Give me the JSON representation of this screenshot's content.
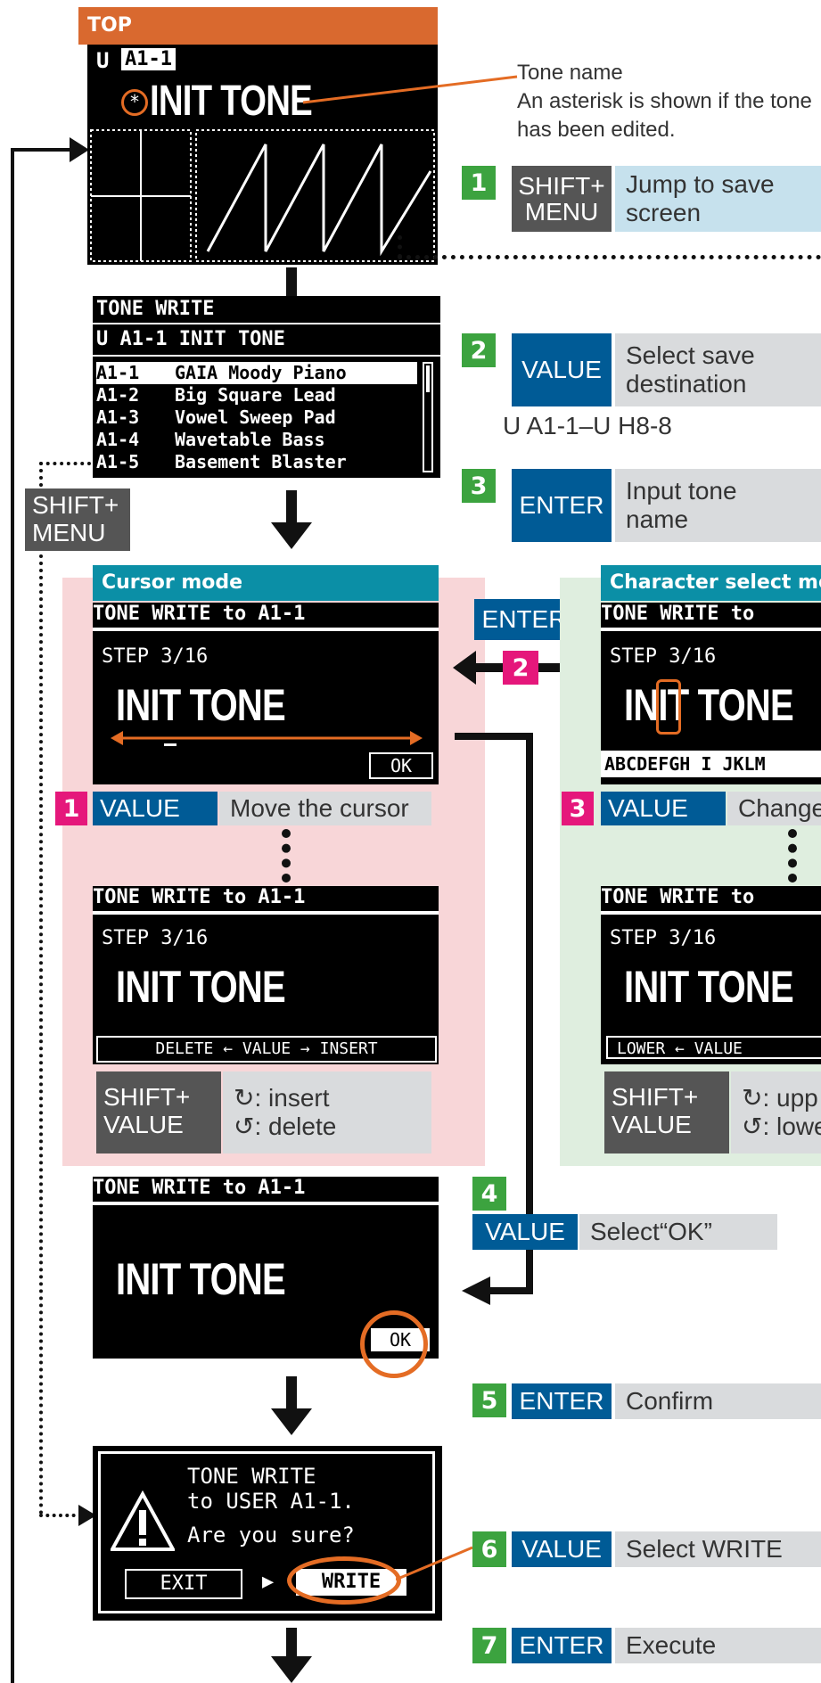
{
  "top": {
    "label": "TOP",
    "header_left": "U",
    "header_patch": "A1-1",
    "tone": "INIT TONE",
    "asterisk": "*"
  },
  "annot": {
    "tone_name": "Tone name",
    "asterisk_note_1": "An asterisk is shown if the tone",
    "asterisk_note_2": "has been edited."
  },
  "steps": {
    "s1": {
      "num": "1",
      "key1": "SHIFT+",
      "key2": "MENU",
      "desc1": "Jump to save",
      "desc2": "screen"
    },
    "s2": {
      "num": "2",
      "key": "VALUE",
      "desc1": "Select save",
      "desc2": "destination",
      "range": "U A1-1–U H8-8"
    },
    "s3": {
      "num": "3",
      "key": "ENTER",
      "desc1": "Input tone",
      "desc2": "name"
    },
    "s4": {
      "num": "4",
      "key": "VALUE",
      "desc": "Select“OK”"
    },
    "s5": {
      "num": "5",
      "key": "ENTER",
      "desc": "Confirm"
    },
    "s6": {
      "num": "6",
      "key": "VALUE",
      "desc": "Select WRITE"
    },
    "s7": {
      "num": "7",
      "key": "ENTER",
      "desc": "Execute"
    }
  },
  "tone_write": {
    "title": "TONE WRITE",
    "current": "U A1-1 INIT TONE",
    "items": [
      {
        "no": "A1-1",
        "name": "GAIA Moody Piano"
      },
      {
        "no": "A1-2",
        "name": "Big Square Lead"
      },
      {
        "no": "A1-3",
        "name": "Vowel Sweep Pad"
      },
      {
        "no": "A1-4",
        "name": "Wavetable Bass"
      },
      {
        "no": "A1-5",
        "name": "Basement Blaster"
      }
    ]
  },
  "shift_menu": {
    "line1": "SHIFT+",
    "line2": "MENU"
  },
  "cursor_mode": {
    "label": "Cursor mode",
    "title": "TONE WRITE to A1-1",
    "step": "STEP 3/16",
    "tone": "INIT TONE",
    "ok": "OK",
    "sub_num": "1",
    "sub_key": "VALUE",
    "sub_desc": "Move the cursor",
    "footer": "DELETE ← VALUE → INSERT",
    "shift1": "SHIFT+",
    "shift2": "VALUE",
    "insert": ": insert",
    "delete": ": delete"
  },
  "char_mode": {
    "label": "Character select mode",
    "title": "TONE WRITE to",
    "step": "STEP 3/16",
    "tone": "INIT TONE",
    "chars": "ABCDEFGH I JKLM",
    "sub_num": "3",
    "sub_key": "VALUE",
    "sub_desc": "Change",
    "footer": "LOWER ← VALUE",
    "shift1": "SHIFT+",
    "shift2": "VALUE",
    "upper": ": upp",
    "lower": ": lowe"
  },
  "mid": {
    "enter": "ENTER",
    "num": "2"
  },
  "confirm": {
    "title": "TONE WRITE to A1-1",
    "tone": "INIT TONE",
    "ok": "OK"
  },
  "dialog": {
    "line1": "TONE WRITE",
    "line2": "to USER A1-1.",
    "line3": "Are you sure?",
    "exit": "EXIT",
    "write": "WRITE"
  }
}
